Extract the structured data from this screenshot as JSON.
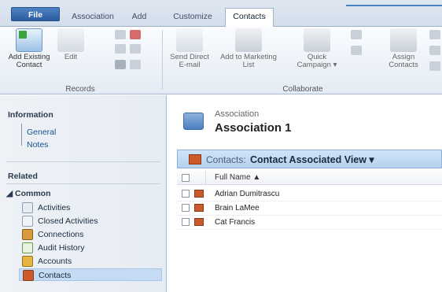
{
  "ribbon_tabs": [
    "File",
    "Association",
    "Add",
    "Customize",
    "Contacts"
  ],
  "ribbon": {
    "records": {
      "add_existing": "Add Existing\nContact",
      "edit": "Edit",
      "label": "Records"
    },
    "collaborate": {
      "send_email": "Send Direct\nE-mail",
      "add_marketing": "Add to Marketing\nList",
      "quick_campaign": "Quick\nCampaign ▾",
      "assign": "Assign\nContacts",
      "label": "Collaborate"
    }
  },
  "nav": {
    "information_heading": "Information",
    "info_links": [
      "General",
      "Notes"
    ],
    "related_heading": "Related",
    "common_heading": "◢ Common",
    "items": [
      "Activities",
      "Closed Activities",
      "Connections",
      "Audit History",
      "Accounts",
      "Contacts"
    ],
    "selected": "Contacts"
  },
  "main": {
    "entity_type": "Association",
    "entity_name": "Association 1",
    "view_prefix": "Contacts:",
    "view_name": "Contact Associated View ▾",
    "column": "Full Name ▲",
    "rows": [
      "Adrian Dumitrascu",
      "Brain LaMee",
      "Cat Francis"
    ]
  },
  "colors": {
    "accent": "#2c5c9d",
    "view_bar": "#b6d2ef",
    "selected_nav": "#c5daf3",
    "contact_icon": "#cc5a2b"
  }
}
